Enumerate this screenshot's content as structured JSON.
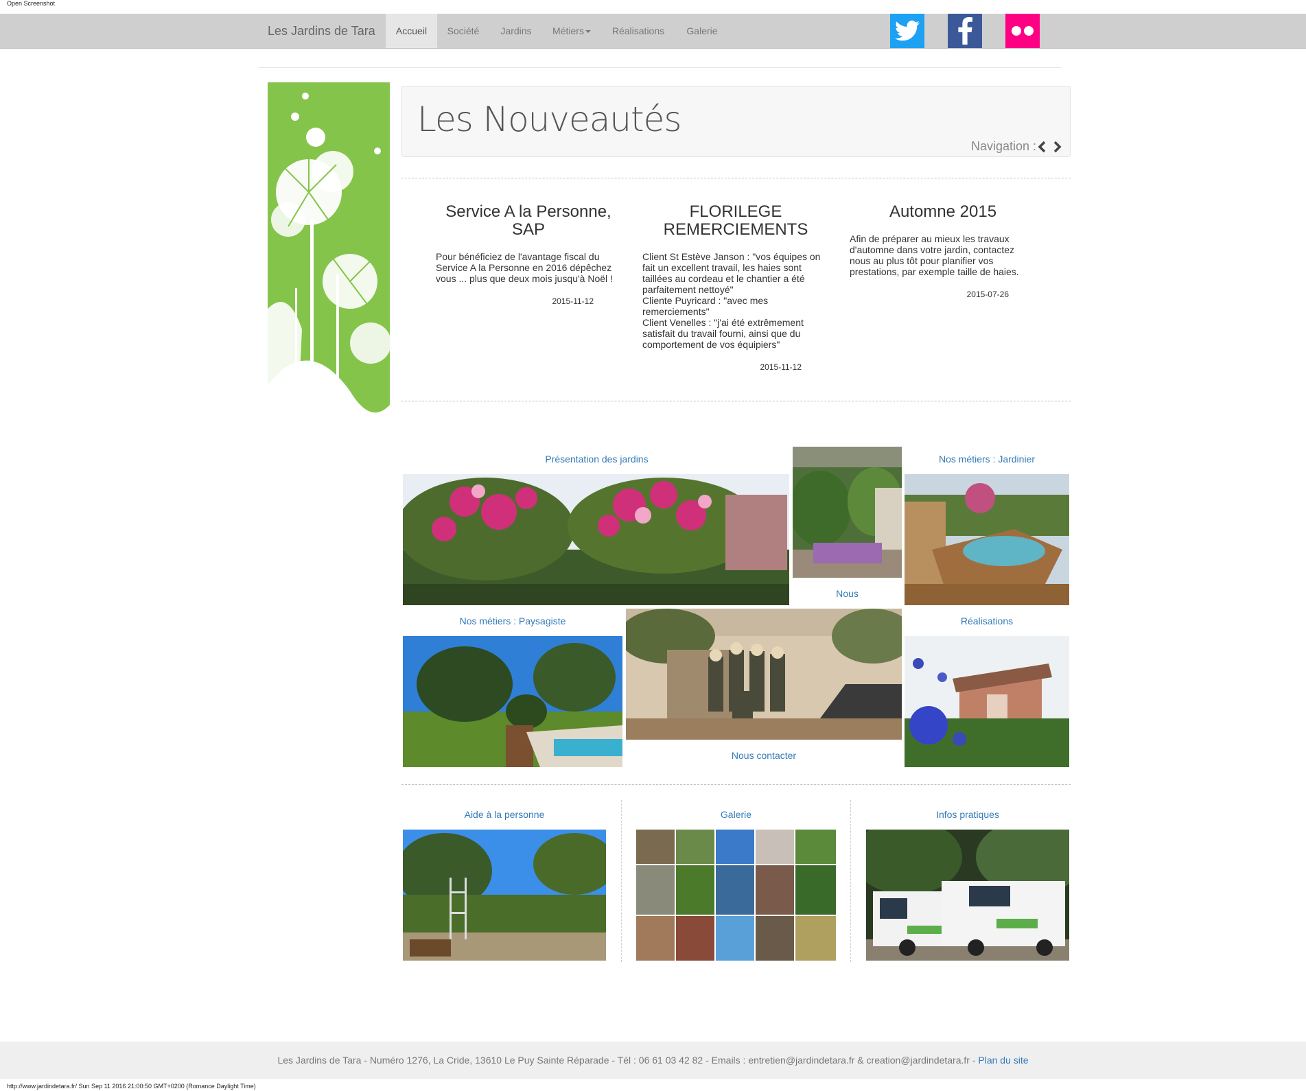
{
  "topbar": {
    "label": "Open Screenshot"
  },
  "nav": {
    "brand": "Les Jardins de Tara",
    "items": [
      {
        "label": "Accueil"
      },
      {
        "label": "Société"
      },
      {
        "label": "Jardins"
      },
      {
        "label": "Métiers"
      },
      {
        "label": "Réalisations"
      },
      {
        "label": "Galerie"
      }
    ],
    "social": [
      {
        "name": "twitter-icon",
        "color": "#1da1f2"
      },
      {
        "name": "facebook-icon",
        "color": "#3b5998"
      },
      {
        "name": "flickr-icon",
        "color": "#ff0084"
      }
    ]
  },
  "news_header": {
    "title": "Les Nouveautés",
    "navigation_label": "Navigation :"
  },
  "news": [
    {
      "title": "Service A la Personne, SAP",
      "text": "Pour bénéficiez de l'avantage fiscal du Service A la Personne en 2016 dépêchez vous ... plus que deux mois jusqu'à Noël !",
      "date": "2015-11-12"
    },
    {
      "title": "FLORILEGE REMERCIEMENTS",
      "text": "Client St Estève Janson : \"vos équipes on fait un excellent travail, les haies sont taillées au cordeau et le chantier a été parfaitement nettoyé\"\nCliente Puyricard : \"avec mes remerciements\"\nClient Venelles : \"j'ai été extrêmement satisfait du travail fourni, ainsi que du comportement de vos équipiers\"",
      "date": "2015-11-12"
    },
    {
      "title": "Automne 2015",
      "text": "Afin de préparer au mieux les travaux d'automne dans votre jardin, contactez nous au plus tôt pour planifier vos prestations, par exemple taille de haies.",
      "date": "2015-07-26"
    }
  ],
  "tiles": {
    "presentation": "Présentation des jardins",
    "nous": "Nous",
    "jardinier": "Nos métiers : Jardinier",
    "paysagiste": "Nos métiers : Paysagiste",
    "contact": "Nous contacter",
    "realisations": "Réalisations",
    "aide": "Aide à la personne",
    "galerie": "Galerie",
    "infos": "Infos pratiques"
  },
  "footer": {
    "text": "Les Jardins de Tara - Numéro 1276, La Cride, 13610 Le Puy Sainte Réparade - Tél : 06 61 03 42 82 - Emails : entretien@jardindetara.fr & creation@jardindetara.fr - ",
    "link": "Plan du site"
  },
  "statusbar": {
    "text": "http://www.jardindetara.fr/ Sun Sep 11 2016 21:00:50 GMT+0200 (Romance Daylight Time)"
  }
}
